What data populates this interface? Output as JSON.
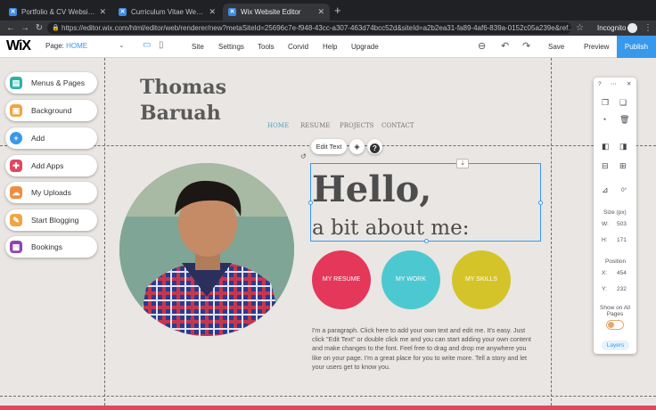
{
  "browser": {
    "tabs": [
      {
        "title": "Portfolio & CV Website Templ",
        "active": false
      },
      {
        "title": "Curriculum Vitae Website Tem",
        "active": false
      },
      {
        "title": "Wix Website Editor",
        "active": true
      }
    ],
    "url": "https://editor.wix.com/html/editor/web/renderer/new?metaSiteId=25696c7e-f948-43cc-a307-463d74bcc52d&siteId=a2b2ea31-fa89-4af6-839a-0152c05a239e&ref...",
    "profile_label": "Incognito"
  },
  "wix": {
    "logo": "WiX",
    "page_label": "Page:",
    "page_value": "HOME",
    "menu": [
      "Site",
      "Settings",
      "Tools",
      "Corvid",
      "Help",
      "Upgrade"
    ],
    "save": "Save",
    "preview": "Preview",
    "publish": "Publish"
  },
  "left_panel": [
    {
      "label": "Menus & Pages",
      "color": "#2bb3a6",
      "icon": "pages-icon"
    },
    {
      "label": "Background",
      "color": "#f0a543",
      "icon": "background-icon"
    },
    {
      "label": "Add",
      "color": "#3899ec",
      "icon": "plus-icon"
    },
    {
      "label": "Add Apps",
      "color": "#e0485e",
      "icon": "apps-icon"
    },
    {
      "label": "My Uploads",
      "color": "#f38b3c",
      "icon": "upload-icon"
    },
    {
      "label": "Start Blogging",
      "color": "#f0a543",
      "icon": "blog-icon"
    },
    {
      "label": "Bookings",
      "color": "#8e44ad",
      "icon": "bookings-icon"
    }
  ],
  "site": {
    "name_line1": "Thomas",
    "name_line2": "Baruah",
    "nav": [
      "HOME",
      "RESUME",
      "PROJECTS",
      "CONTACT"
    ],
    "edit_text": "Edit Text",
    "hello": "Hello,",
    "about": "a bit about me:",
    "circles": [
      {
        "label": "MY RESUME",
        "color": "#e5375a"
      },
      {
        "label": "MY WORK",
        "color": "#4cc9d0"
      },
      {
        "label": "MY SKILLS",
        "color": "#d4c42a"
      }
    ],
    "paragraph": "I'm a paragraph. Click here to add your own text and edit me. It's easy. Just click \"Edit Text\" or double click me and you can start adding your own content and make changes to the font. Feel free to drag and drop me anywhere you like on your page. I'm a great place for you to write more. Tell a story and let your users get to know you."
  },
  "right_panel": {
    "help": "?",
    "rotation": "0°",
    "size_label": "Size (px)",
    "w_label": "W:",
    "w_value": "503",
    "h_label": "H:",
    "h_value": "171",
    "position_label": "Position",
    "x_label": "X:",
    "x_value": "454",
    "y_label": "Y:",
    "y_value": "232",
    "show_all": "Show on All Pages",
    "layers": "Layers"
  }
}
